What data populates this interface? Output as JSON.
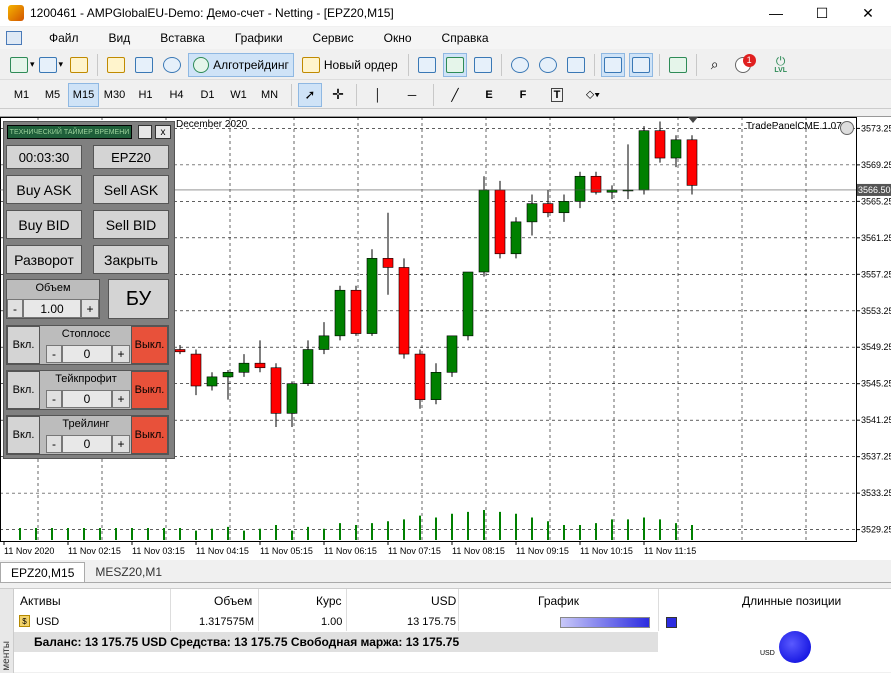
{
  "window": {
    "title": "1200461 - AMPGlobalEU-Demo: Демо-счет - Netting - [EPZ20,M15]",
    "minimize": "—",
    "maximize": "☐",
    "close": "✕"
  },
  "menu": [
    "Файл",
    "Вид",
    "Вставка",
    "Графики",
    "Сервис",
    "Окно",
    "Справка"
  ],
  "toolbar": {
    "algo_label": "Алготрейдинг",
    "new_order_label": "Новый ордер",
    "notification_count": "1",
    "lvl_label": "LVL"
  },
  "timeframes": [
    "M1",
    "M5",
    "M15",
    "M30",
    "H1",
    "H4",
    "D1",
    "W1",
    "MN"
  ],
  "active_timeframe": "M15",
  "chart": {
    "caption": "December 2020",
    "indicator_name": "TradePanelCME.1.07",
    "current_price_label": "3566.50",
    "colors": {
      "up": "#008000",
      "down": "#ff0000",
      "grid": "#000000"
    }
  },
  "chart_data": {
    "type": "candlestick",
    "price_ticks": [
      "3573.25",
      "3569.25",
      "3565.25",
      "3561.25",
      "3557.25",
      "3553.25",
      "3549.25",
      "3545.25",
      "3541.25",
      "3537.25",
      "3533.25",
      "3529.25"
    ],
    "time_ticks": [
      "11 Nov 2020",
      "11 Nov 02:15",
      "11 Nov 03:15",
      "11 Nov 04:15",
      "11 Nov 05:15",
      "11 Nov 06:15",
      "11 Nov 07:15",
      "11 Nov 08:15",
      "11 Nov 09:15",
      "11 Nov 10:15",
      "11 Nov 11:15"
    ],
    "ylim": [
      3528.0,
      3574.5
    ],
    "current_price": 3566.5,
    "candles": [
      [
        3549.0,
        3549.5,
        3548.5,
        3548.75
      ],
      [
        3548.5,
        3549.0,
        3544.0,
        3545.0
      ],
      [
        3545.0,
        3546.5,
        3544.5,
        3546.0
      ],
      [
        3546.0,
        3546.75,
        3543.5,
        3546.5
      ],
      [
        3546.5,
        3548.5,
        3546.0,
        3547.5
      ],
      [
        3547.5,
        3550.0,
        3546.5,
        3547.0
      ],
      [
        3547.0,
        3547.5,
        3540.5,
        3542.0
      ],
      [
        3542.0,
        3545.5,
        3540.5,
        3545.25
      ],
      [
        3545.25,
        3550.0,
        3545.0,
        3549.0
      ],
      [
        3549.0,
        3552.0,
        3548.5,
        3550.5
      ],
      [
        3550.5,
        3556.0,
        3550.0,
        3555.5
      ],
      [
        3555.5,
        3556.0,
        3550.5,
        3550.75
      ],
      [
        3550.75,
        3560.0,
        3550.5,
        3559.0
      ],
      [
        3559.0,
        3564.0,
        3555.0,
        3558.0
      ],
      [
        3558.0,
        3559.0,
        3548.0,
        3548.5
      ],
      [
        3548.5,
        3549.0,
        3542.5,
        3543.5
      ],
      [
        3543.5,
        3547.5,
        3543.0,
        3546.5
      ],
      [
        3546.5,
        3550.5,
        3546.0,
        3550.5
      ],
      [
        3550.5,
        3557.5,
        3550.0,
        3557.5
      ],
      [
        3557.5,
        3568.0,
        3557.0,
        3566.5
      ],
      [
        3566.5,
        3567.5,
        3559.0,
        3559.5
      ],
      [
        3559.5,
        3563.5,
        3559.0,
        3563.0
      ],
      [
        3563.0,
        3566.0,
        3561.5,
        3565.0
      ],
      [
        3565.0,
        3566.5,
        3563.5,
        3564.0
      ],
      [
        3564.0,
        3566.0,
        3563.0,
        3565.25
      ],
      [
        3565.25,
        3568.5,
        3564.5,
        3568.0
      ],
      [
        3568.0,
        3568.5,
        3566.0,
        3566.25
      ],
      [
        3566.25,
        3567.0,
        3565.5,
        3566.5
      ],
      [
        3566.5,
        3571.5,
        3565.5,
        3566.5
      ],
      [
        3566.5,
        3573.5,
        3566.0,
        3573.0
      ],
      [
        3573.0,
        3574.0,
        3569.5,
        3570.0
      ],
      [
        3570.0,
        3572.5,
        3569.0,
        3572.0
      ],
      [
        3572.0,
        3572.5,
        3566.0,
        3567.0
      ]
    ],
    "volumes": [
      4,
      5,
      6,
      7,
      5,
      6,
      8,
      5,
      7,
      6,
      9,
      8,
      9,
      10,
      11,
      13,
      12,
      14,
      15,
      16,
      15,
      14,
      12,
      10,
      8,
      8,
      9,
      11,
      11,
      12,
      11,
      9,
      8
    ]
  },
  "panel": {
    "header": "ТЕХНИЧЕСКИЙ ТАЙМЕР ВРЕМЕНИ",
    "close": "x",
    "timer": "00:03:30",
    "symbol": "EPZ20",
    "buy_ask": "Buy ASK",
    "sell_ask": "Sell ASK",
    "buy_bid": "Buy BID",
    "sell_bid": "Sell BID",
    "reverse": "Разворот",
    "close_pos": "Закрыть",
    "volume_label": "Объем",
    "volume_value": "1.00",
    "minus": "-",
    "plus": "+",
    "bu": "БУ",
    "on": "Вкл.",
    "off": "Выкл.",
    "stoploss_label": "Стоплосс",
    "stoploss_value": "0",
    "takeprofit_label": "Тейкпрофит",
    "takeprofit_value": "0",
    "trailing_label": "Трейлинг",
    "trailing_value": "0"
  },
  "tabs": [
    "EPZ20,M15",
    "MESZ20,M1"
  ],
  "assets_table": {
    "headers": [
      "Активы",
      "Объем",
      "Курс",
      "USD",
      "График",
      "Длинные позиции"
    ],
    "row": {
      "asset": "USD",
      "volume": "1.317575M",
      "rate": "1.00",
      "usd": "13 175.75"
    },
    "balance": "Баланс: 13 175.75 USD  Средства: 13 175.75  Свободная маржа: 13 175.75",
    "side_label": "менты",
    "pie_label": "USD"
  }
}
